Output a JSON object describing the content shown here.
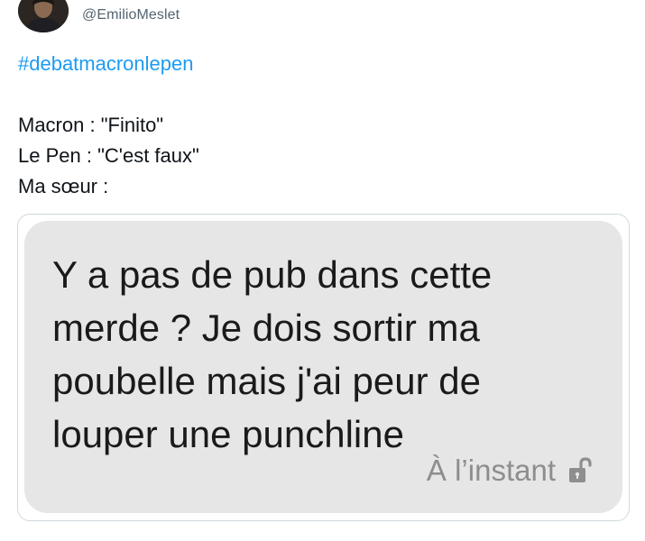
{
  "tweet": {
    "author_handle": "@EmilioMeslet",
    "hashtag": "#debatmacronlepen",
    "lines": [
      "Macron : \"Finito\"",
      "Le Pen : \"C'est faux\"",
      "Ma sœur :"
    ]
  },
  "media": {
    "message_lines": [
      "Y a pas de pub dans cette",
      "merde ? Je dois sortir ma",
      "poubelle mais j'ai peur de",
      "louper une punchline"
    ],
    "timestamp": "À l’instant",
    "status_icon": "unlocked-padlock-icon"
  },
  "colors": {
    "link": "#1d9bf0",
    "handle": "#536471",
    "bubble_bg": "#e6e6e6",
    "meta_text": "#8e8e8e"
  }
}
